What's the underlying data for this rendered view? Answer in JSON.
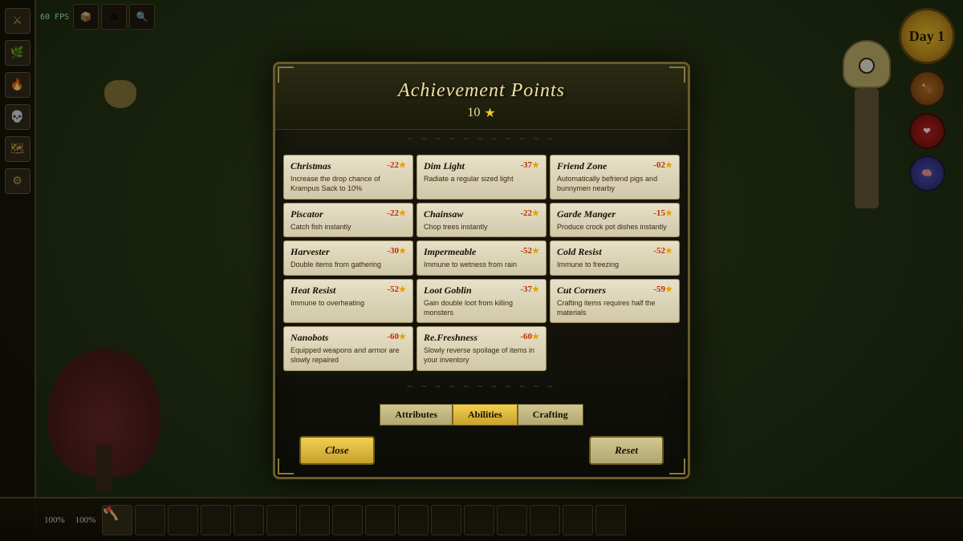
{
  "hud": {
    "fps": "60 FPS",
    "day": "Day 1",
    "health_pct": "100%",
    "hunger_pct": "100%"
  },
  "dialog": {
    "title": "Achievement Points",
    "points": "10",
    "star": "★",
    "tabs": [
      {
        "label": "Attributes",
        "active": false
      },
      {
        "label": "Abilities",
        "active": true
      },
      {
        "label": "Crafting",
        "active": false
      }
    ],
    "close_label": "Close",
    "reset_label": "Reset",
    "achievements": [
      {
        "title": "Christmas",
        "cost": "-22",
        "desc": "Increase the drop chance of Krampus Sack to 10%"
      },
      {
        "title": "Dim Light",
        "cost": "-37",
        "desc": "Radiate a regular sized light"
      },
      {
        "title": "Friend Zone",
        "cost": "-02",
        "desc": "Automatically befriend pigs and bunnymen nearby"
      },
      {
        "title": "Piscator",
        "cost": "-22",
        "desc": "Catch fish instantly"
      },
      {
        "title": "Chainsaw",
        "cost": "-22",
        "desc": "Chop trees instantly"
      },
      {
        "title": "Garde Manger",
        "cost": "-15",
        "desc": "Produce crock pot dishes instantly"
      },
      {
        "title": "Harvester",
        "cost": "-30",
        "desc": "Double items from gathering"
      },
      {
        "title": "Impermeable",
        "cost": "-52",
        "desc": "Immune to wetness from rain"
      },
      {
        "title": "Cold Resist",
        "cost": "-52",
        "desc": "Immune to freezing"
      },
      {
        "title": "Heat Resist",
        "cost": "-52",
        "desc": "Immune to overheating"
      },
      {
        "title": "Loot Goblin",
        "cost": "-37",
        "desc": "Gain double loot from killing monsters"
      },
      {
        "title": "Cut Corners",
        "cost": "-59",
        "desc": "Crafting items requires half the materials"
      },
      {
        "title": "Nanobots",
        "cost": "-60",
        "desc": "Equipped weapons and armor are slowly repaired"
      },
      {
        "title": "Re.Freshness",
        "cost": "-60",
        "desc": "Slowly reverse spoilage of items in your inventory"
      }
    ]
  },
  "sidebar": {
    "icons": [
      "⚔",
      "🌿",
      "🔥",
      "💀",
      "🗺",
      "⚙"
    ]
  },
  "hotbar": {
    "slots": 16
  }
}
